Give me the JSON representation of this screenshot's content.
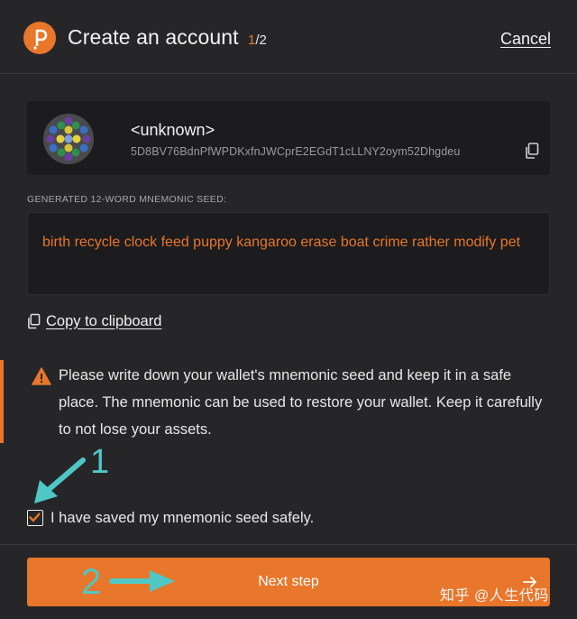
{
  "colors": {
    "accent": "#e8762b",
    "background": "#262628",
    "card": "#1c1c1e",
    "annotation": "#4fc7c4"
  },
  "header": {
    "logo_icon": "polkadot-logo-icon",
    "title": "Create an account",
    "step_current": "1",
    "step_total": "/2",
    "cancel_label": "Cancel"
  },
  "account": {
    "name": "<unknown>",
    "address": "5D8BV76BdnPfWPDKxfnJWCprE2EGdT1cLLNY2oym52Dhgdeu",
    "copy_icon": "copy-icon"
  },
  "seed": {
    "label": "GENERATED 12-WORD MNEMONIC SEED:",
    "text": "birth recycle clock feed puppy kangaroo erase boat crime rather modify pet"
  },
  "copy_link": {
    "label": "Copy to clipboard",
    "icon": "copy-icon"
  },
  "warning": {
    "icon": "warning-icon",
    "text": "Please write down your wallet's mnemonic seed and keep it in a safe place. The mnemonic can be used to restore your wallet. Keep it carefully to not lose your assets."
  },
  "confirm": {
    "label": "I have saved my mnemonic seed safely.",
    "checked": true
  },
  "next_button": {
    "label": "Next step",
    "icon": "arrow-right-icon"
  },
  "annotations": {
    "one": "1",
    "two": "2"
  },
  "watermark": "知乎 @人生代码"
}
